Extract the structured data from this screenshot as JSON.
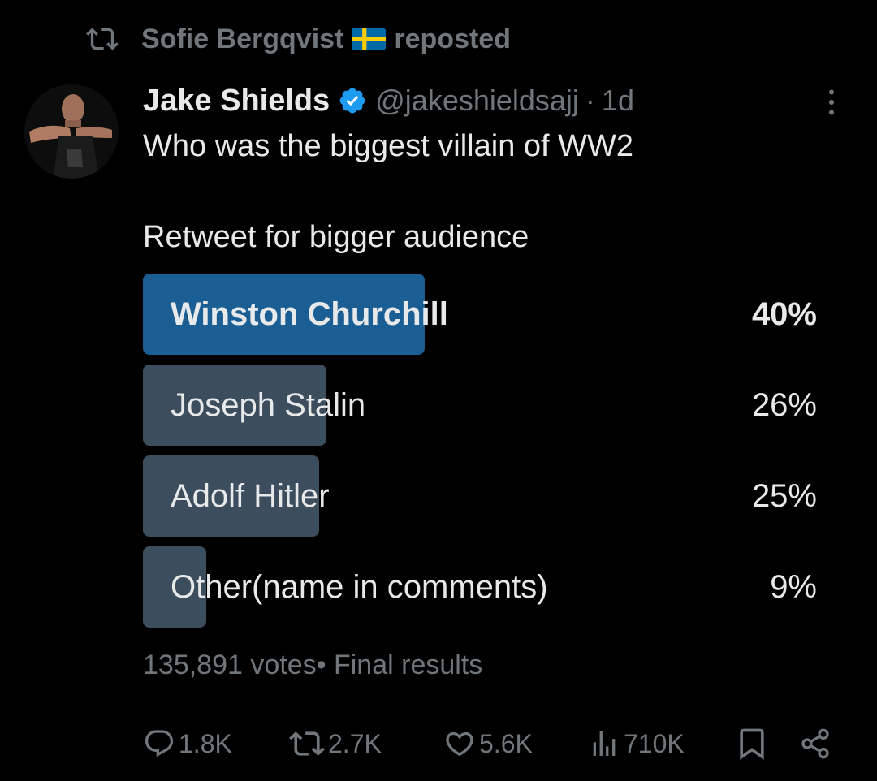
{
  "repost": {
    "user": "Sofie Bergqvist",
    "flag": "swedish-flag",
    "label": "reposted"
  },
  "author": {
    "name": "Jake Shields",
    "handle": "@jakeshieldsajj",
    "separator": "·",
    "time": "1d"
  },
  "tweet": {
    "line1": "Who was the biggest villain of WW2",
    "line2": "Retweet for bigger audience"
  },
  "poll": {
    "options": [
      {
        "label": "Winston Churchill",
        "percent_text": "40%",
        "percent": 40,
        "winner": true
      },
      {
        "label": "Joseph Stalin",
        "percent_text": "26%",
        "percent": 26,
        "winner": false
      },
      {
        "label": "Adolf Hitler",
        "percent_text": "25%",
        "percent": 25,
        "winner": false
      },
      {
        "label": "Other(name in comments)",
        "percent_text": "9%",
        "percent": 9,
        "winner": false
      }
    ],
    "votes": "135,891 votes",
    "status": "• Final results"
  },
  "actions": {
    "replies": "1.8K",
    "reposts": "2.7K",
    "likes": "5.6K",
    "views": "710K"
  },
  "colors": {
    "background": "#000000",
    "text_primary": "#e7e9ea",
    "text_secondary": "#71767b",
    "winner_bar": "#1a5e93",
    "other_bar": "#3c4d5d",
    "verified": "#1d9bf0"
  }
}
